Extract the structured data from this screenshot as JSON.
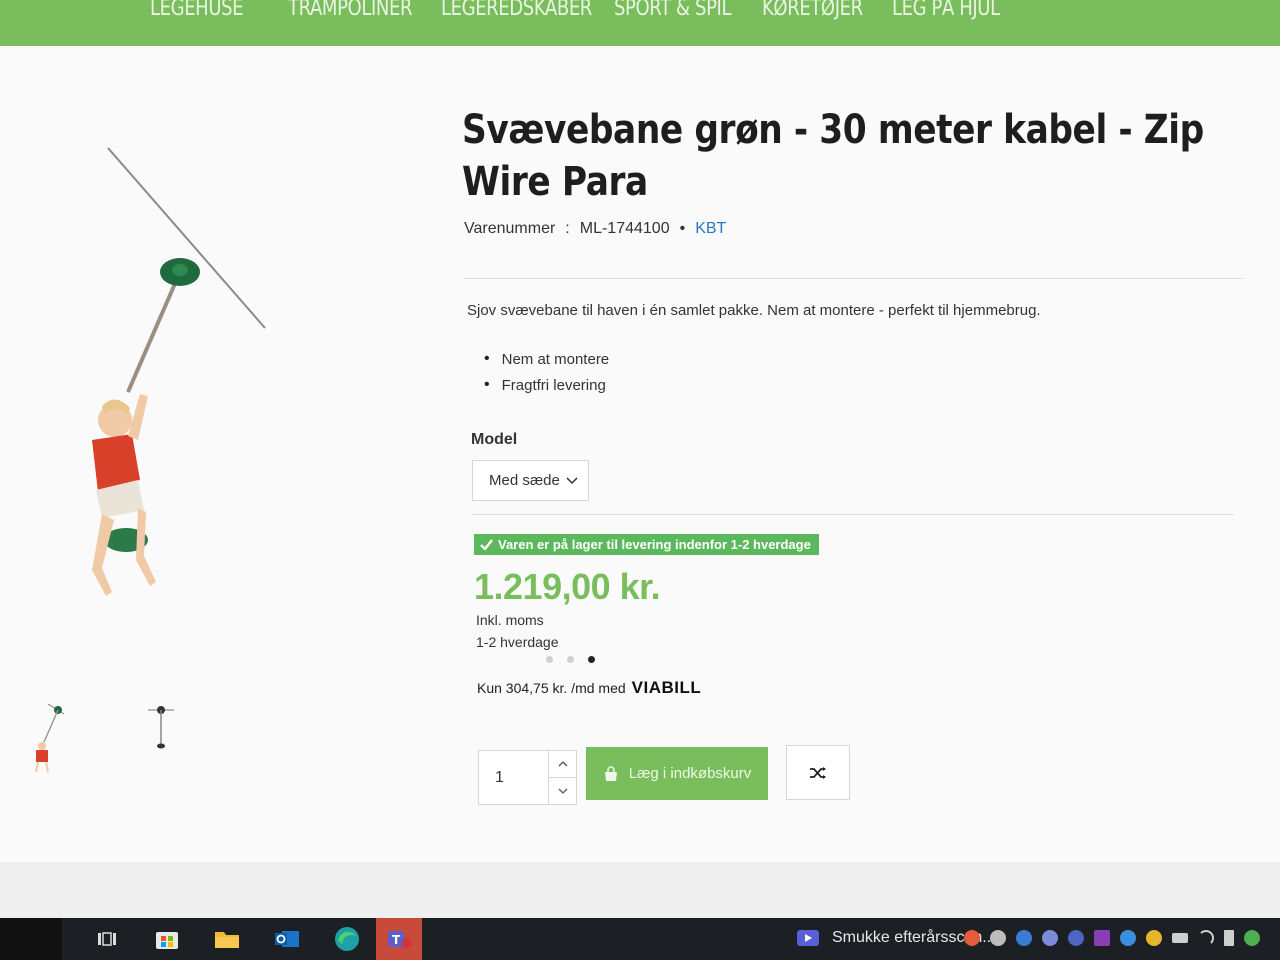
{
  "nav": {
    "items": [
      "LEGEHUSE",
      "TRAMPOLINER",
      "LEGEREDSKABER",
      "SPORT & SPIL",
      "KØRETØJER",
      "LEG PÅ HJUL"
    ]
  },
  "product": {
    "title": "Svævebane grøn - 30 meter kabel - Zip Wire Para",
    "sku_label": "Varenummer",
    "sku_sep": ":",
    "sku": "ML-1744100",
    "bullet": "•",
    "brand": "KBT",
    "description": "Sjov svævebane til haven i én samlet pakke. Nem at montere - perfekt til hjemmebrug.",
    "features": [
      "Nem at montere",
      "Fragtfri levering"
    ]
  },
  "model": {
    "label": "Model",
    "selected": "Med sæde"
  },
  "stock": {
    "text": "Varen er på lager til levering indenfor 1-2 hverdage"
  },
  "price": {
    "amount": "1.219,00 kr.",
    "vat": "Inkl. moms",
    "delivery": "1-2 hverdage"
  },
  "carousel": {
    "count": 3,
    "active": 3
  },
  "viabill": {
    "text": "Kun 304,75 kr. /md med",
    "logo": "VIABILL"
  },
  "cart": {
    "quantity": "1",
    "add_label": "Læg i indkøbskurv"
  },
  "taskbar": {
    "media_title": "Smukke efterårsscen..."
  },
  "colors": {
    "brand_green": "#79bd5c",
    "stock_green": "#5cb85c",
    "link_blue": "#2a78c4"
  },
  "icons": {
    "stock": "check-icon",
    "cart": "shopping-bag-icon",
    "compare": "shuffle-icon",
    "select": "chevron-down-icon"
  }
}
